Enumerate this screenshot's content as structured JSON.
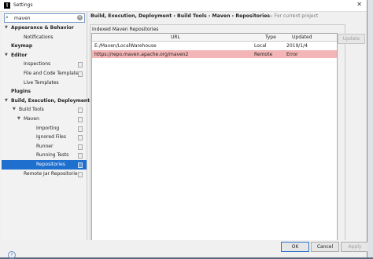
{
  "window": {
    "title": "Settings",
    "close_glyph": "✕"
  },
  "search": {
    "value": "maven"
  },
  "tree": [
    {
      "label": "Appearance & Behavior",
      "bold": true,
      "indent": 0,
      "arrow": "▼",
      "copy": false
    },
    {
      "label": "Notifications",
      "bold": false,
      "indent": 2,
      "arrow": "",
      "copy": false
    },
    {
      "label": "Keymap",
      "bold": true,
      "indent": 0,
      "arrow": "",
      "copy": false
    },
    {
      "label": "Editor",
      "bold": true,
      "indent": 0,
      "arrow": "▼",
      "copy": false
    },
    {
      "label": "Inspections",
      "bold": false,
      "indent": 2,
      "arrow": "",
      "copy": true
    },
    {
      "label": "File and Code Templates",
      "bold": false,
      "indent": 2,
      "arrow": "",
      "copy": true
    },
    {
      "label": "Live Templates",
      "bold": false,
      "indent": 2,
      "arrow": "",
      "copy": false
    },
    {
      "label": "Plugins",
      "bold": true,
      "indent": 0,
      "arrow": "",
      "copy": false
    },
    {
      "label": "Build, Execution, Deployment",
      "bold": true,
      "indent": 0,
      "arrow": "▼",
      "copy": false
    },
    {
      "label": "Build Tools",
      "bold": false,
      "indent": 1,
      "arrow": "▼",
      "copy": true
    },
    {
      "label": "Maven",
      "bold": false,
      "indent": 2,
      "arrow": "▼",
      "copy": true
    },
    {
      "label": "Importing",
      "bold": false,
      "indent": 3,
      "arrow": "",
      "copy": true
    },
    {
      "label": "Ignored Files",
      "bold": false,
      "indent": 3,
      "arrow": "",
      "copy": true
    },
    {
      "label": "Runner",
      "bold": false,
      "indent": 3,
      "arrow": "",
      "copy": true
    },
    {
      "label": "Running Tests",
      "bold": false,
      "indent": 3,
      "arrow": "",
      "copy": true
    },
    {
      "label": "Repositories",
      "bold": false,
      "indent": 3,
      "arrow": "",
      "copy": true,
      "selected": true
    },
    {
      "label": "Remote Jar Repositories",
      "bold": false,
      "indent": 2,
      "arrow": "",
      "copy": true
    }
  ],
  "breadcrumb": "Build, Execution, Deployment  ›  Build Tools  ›  Maven  ›  Repositories",
  "scope": "For current project",
  "group_label": "Indexed Maven Repositories",
  "table": {
    "headers": {
      "url": "URL",
      "type": "Type",
      "updated": "Updated"
    },
    "rows": [
      {
        "url": "E:/Maven/LocalWarehouse",
        "type": "Local",
        "updated": "2019/1/4",
        "error": false
      },
      {
        "url": "https://repo.maven.apache.org/maven2",
        "type": "Remote",
        "updated": "Error",
        "error": true
      }
    ]
  },
  "buttons": {
    "update": "Update",
    "ok": "OK",
    "cancel": "Cancel",
    "apply": "Apply"
  },
  "help_glyph": "?"
}
